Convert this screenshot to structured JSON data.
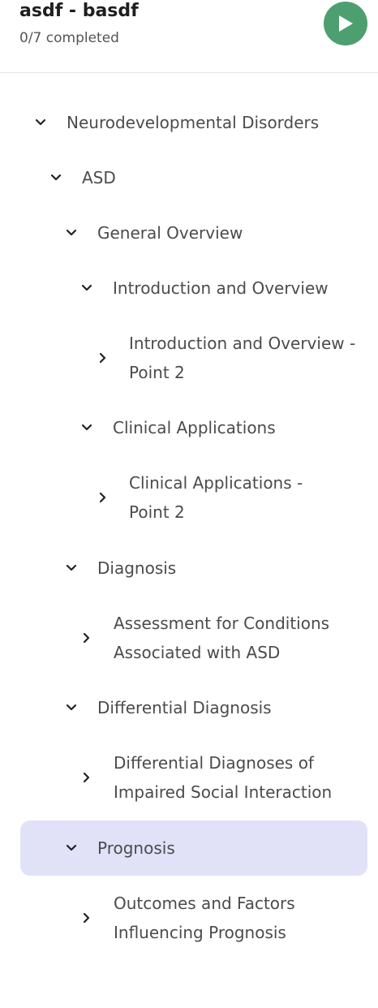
{
  "header": {
    "title": "asdf - basdf",
    "subtitle": "0/7 completed"
  },
  "colors": {
    "play_button": "#4e9f6f",
    "selected_row": "#e1e2f8",
    "text": "#4b4b4b"
  },
  "tree": {
    "items": [
      {
        "label": "Neurodevelopmental Disorders",
        "state": "expanded",
        "level": 0
      },
      {
        "label": "ASD",
        "state": "expanded",
        "level": 1
      },
      {
        "label": "General Overview",
        "state": "expanded",
        "level": 2
      },
      {
        "label": "Introduction and Overview",
        "state": "expanded",
        "level": 3
      },
      {
        "label": "Introduction and Overview - Point 2",
        "state": "collapsed",
        "level": 4
      },
      {
        "label": "Clinical Applications",
        "state": "expanded",
        "level": 3
      },
      {
        "label": "Clinical Applications - Point 2",
        "state": "collapsed",
        "level": 4
      },
      {
        "label": "Diagnosis",
        "state": "expanded",
        "level": 2
      },
      {
        "label": "Assessment for Conditions Associated with ASD",
        "state": "collapsed",
        "level": 3
      },
      {
        "label": "Differential Diagnosis",
        "state": "expanded",
        "level": 2
      },
      {
        "label": "Differential Diagnoses of Impaired Social Interaction",
        "state": "collapsed",
        "level": 3
      },
      {
        "label": "Prognosis",
        "state": "expanded",
        "level": 2,
        "selected": true
      },
      {
        "label": "Outcomes and Factors Influencing Prognosis",
        "state": "collapsed",
        "level": 3
      }
    ]
  }
}
